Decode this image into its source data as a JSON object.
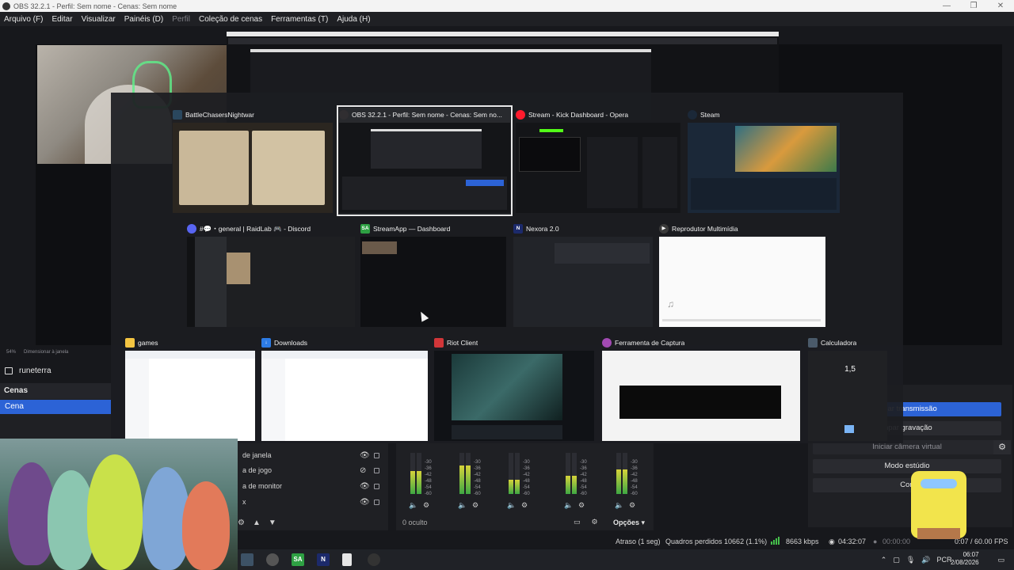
{
  "window": {
    "title": "OBS 32.2.1 - Perfil: Sem nome - Cenas: Sem nome",
    "minimize": "—",
    "maximize": "❐",
    "close": "✕"
  },
  "menu": [
    {
      "label": "Arquivo (F)"
    },
    {
      "label": "Editar"
    },
    {
      "label": "Visualizar"
    },
    {
      "label": "Painéis (D)"
    },
    {
      "label": "Perfil"
    },
    {
      "label": "Coleção de cenas"
    },
    {
      "label": "Ferramentas (T)"
    },
    {
      "label": "Ajuda (H)"
    }
  ],
  "preview": {
    "zoom": "54%",
    "resize_label": "Dimensionar à janela"
  },
  "scene_header": {
    "name": "runeterra"
  },
  "scenes": {
    "title": "Cenas",
    "items": [
      "Cena"
    ]
  },
  "sources": {
    "items": [
      "de janela",
      "a de jogo",
      "a de monitor",
      "x"
    ]
  },
  "mixer": {
    "scale": [
      "-30",
      "-36",
      "-42",
      "-48",
      "-54",
      "-60"
    ],
    "hidden_label": "0 oculto",
    "options_label": "Opções",
    "channels": [
      {
        "level": 0.55,
        "muted": false
      },
      {
        "level": 0.7,
        "muted": true
      },
      {
        "level": 0.35,
        "muted": false
      },
      {
        "level": 0.45,
        "muted": false
      },
      {
        "level": 0.6,
        "muted": false
      }
    ]
  },
  "controls": {
    "stream": "mpar transmissão",
    "record": "mpar gravação",
    "virtual_cam": "Iniciar câmera virtual",
    "studio_mode": "Modo estúdio",
    "settings": "Con"
  },
  "status": {
    "delay": "Atraso (1 seg)",
    "dropped_frames": "Quadros perdidos 10662 (1.1%)",
    "bitrate": "8663 kbps",
    "stream_time": "04:32:07",
    "rec_time": "00:00:00",
    "fps": "0:07 / 60.00 FPS"
  },
  "taskbar": {
    "apps": [
      {
        "name": "calculator",
        "label": ""
      },
      {
        "name": "riot",
        "label": ""
      },
      {
        "name": "streamapp",
        "label": "SA"
      },
      {
        "name": "nexora",
        "label": "N"
      },
      {
        "name": "file",
        "label": ""
      },
      {
        "name": "obs",
        "label": ""
      }
    ],
    "lang": "PCR",
    "time": "06:07",
    "date": "2/08/2026"
  },
  "alttab": {
    "windows": [
      {
        "title": "BattleChasersNightwar",
        "icon": "steam-icon",
        "icon_color": "#2a475e"
      },
      {
        "title": "OBS 32.2.1 - Perfil: Sem nome - Cenas: Sem no...",
        "icon": "obs-icon",
        "icon_color": "#302e31",
        "selected": true
      },
      {
        "title": "Stream - Kick Dashboard - Opera",
        "icon": "opera-icon",
        "icon_color": "#ff1b2d"
      },
      {
        "title": "Steam",
        "icon": "steam-icon",
        "icon_color": "#1b2838"
      },
      {
        "title": "#💬・general | RaidLab 🎮 - Discord",
        "icon": "discord-icon",
        "icon_color": "#5865f2"
      },
      {
        "title": "StreamApp — Dashboard",
        "icon": "streamapp-icon",
        "icon_color": "#2ea043",
        "icon_text": "SA"
      },
      {
        "title": "Nexora 2.0",
        "icon": "nexora-icon",
        "icon_color": "#1c2a6b",
        "icon_text": "N"
      },
      {
        "title": "Reprodutor Multimídia",
        "icon": "media-player-icon",
        "icon_color": "#3a3a3a"
      },
      {
        "title": "games",
        "icon": "folder-icon",
        "icon_color": "#f4c542"
      },
      {
        "title": "Downloads",
        "icon": "download-icon",
        "icon_color": "#2d7be5"
      },
      {
        "title": "Riot Client",
        "icon": "riot-icon",
        "icon_color": "#d13639"
      },
      {
        "title": "Ferramenta de Captura",
        "icon": "snip-icon",
        "icon_color": "#a24ab3"
      },
      {
        "title": "Calculadora",
        "icon": "calculator-icon",
        "icon_color": "#4a5a6a"
      }
    ],
    "calc_display": "1,5"
  }
}
